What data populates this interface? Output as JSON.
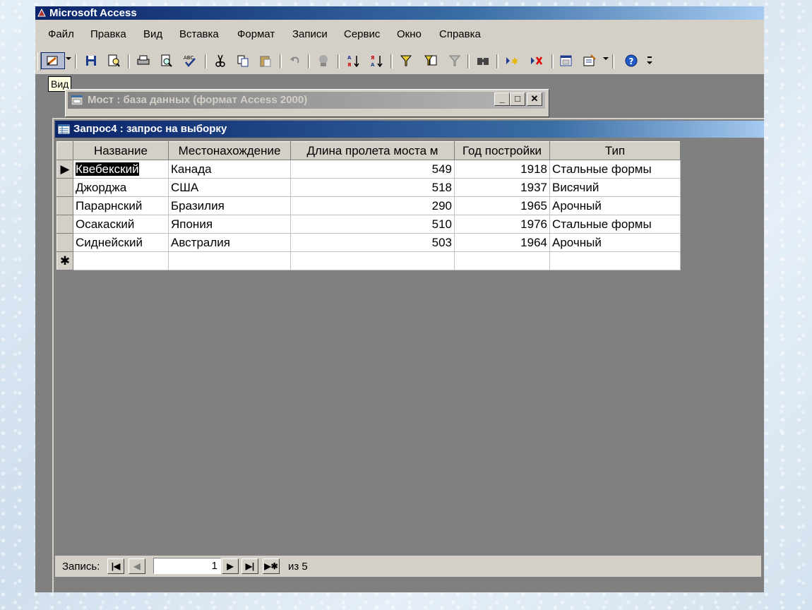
{
  "app": {
    "title": "Microsoft Access"
  },
  "menu": [
    "Файл",
    "Правка",
    "Вид",
    "Вставка",
    "Формат",
    "Записи",
    "Сервис",
    "Окно",
    "Справка"
  ],
  "toolbar": {
    "tooltip": "Вид",
    "icons": [
      "view-icon",
      "save-icon",
      "file-search-icon",
      "print-icon",
      "print-preview-icon",
      "spelling-icon",
      "cut-icon",
      "copy-icon",
      "paste-icon",
      "undo-icon",
      "insert-hyperlink-icon",
      "sort-ascending-icon",
      "sort-descending-icon",
      "filter-by-selection-icon",
      "filter-by-form-icon",
      "apply-filter-icon",
      "find-icon",
      "new-record-icon",
      "delete-record-icon",
      "database-window-icon",
      "new-object-icon",
      "help-icon"
    ]
  },
  "db_window": {
    "title": "Мост : база данных (формат Access 2000)"
  },
  "query_window": {
    "title": "Запрос4 : запрос на выборку",
    "columns": [
      "Название",
      "Местонахождение",
      "Длина пролета моста м",
      "Год постройки",
      "Тип"
    ],
    "rows": [
      [
        "Квебекский",
        "Канада",
        "549",
        "1918",
        "Стальные формы"
      ],
      [
        "Джорджа",
        "США",
        "518",
        "1937",
        "Висячий"
      ],
      [
        "Парарнский",
        "Бразилия",
        "290",
        "1965",
        "Арочный"
      ],
      [
        "Осакаский",
        "Япония",
        "510",
        "1976",
        "Стальные формы"
      ],
      [
        "Сиднейский",
        "Австралия",
        "503",
        "1964",
        "Арочный"
      ]
    ],
    "current_row_marker": "▶",
    "new_row_marker": "✱"
  },
  "navigator": {
    "label": "Запись:",
    "current": "1",
    "of_text": "из 5"
  }
}
